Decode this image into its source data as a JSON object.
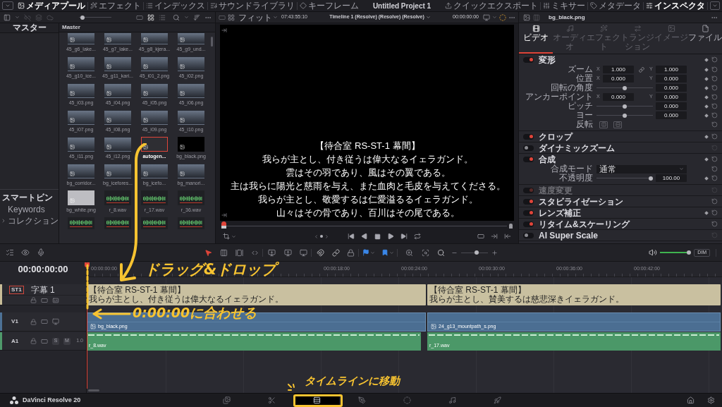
{
  "top_bar": {
    "left_tabs": [
      {
        "label": "メディアプール",
        "kind": "media",
        "selected": true
      },
      {
        "label": "エフェクト",
        "kind": "effects",
        "selected": false
      },
      {
        "label": "インデックス",
        "kind": "index",
        "selected": false
      },
      {
        "label": "サウンドライブラリ",
        "kind": "sound",
        "selected": false
      },
      {
        "label": "キーフレーム",
        "kind": "keyframe",
        "selected": false
      }
    ],
    "title": "Untitled Project 1",
    "right_tabs": [
      {
        "label": "クイックエクスポート",
        "kind": "export",
        "selected": false
      },
      {
        "label": "ミキサー",
        "kind": "mixer",
        "selected": false
      },
      {
        "label": "メタデータ",
        "kind": "metadata",
        "selected": false
      },
      {
        "label": "インスペクタ",
        "kind": "inspector",
        "selected": true
      }
    ]
  },
  "media_pool": {
    "thumbnail_size": {
      "level": 0.05
    },
    "view_modes": [
      {
        "kind": "strip",
        "selected": false
      },
      {
        "kind": "grid",
        "selected": true
      },
      {
        "kind": "list",
        "selected": false
      }
    ],
    "bins_header": "マスター",
    "smart_bins": {
      "title": "スマートビン",
      "items": [
        {
          "label": "Keywords",
          "kind": "item"
        },
        {
          "label": "コレクション",
          "kind": "folder"
        }
      ]
    },
    "header": "Master",
    "clips": [
      {
        "name": "45_g6_lake...",
        "kind": "photo",
        "selected": false
      },
      {
        "name": "45_g7_lake...",
        "kind": "photo",
        "selected": false
      },
      {
        "name": "45_g8_kjera...",
        "kind": "photo",
        "selected": false
      },
      {
        "name": "45_g9_und...",
        "kind": "photo",
        "selected": false
      },
      {
        "name": "45_g10_ice...",
        "kind": "photo",
        "selected": false
      },
      {
        "name": "45_g11_kari...",
        "kind": "photo",
        "selected": false
      },
      {
        "name": "45_i01_2.png",
        "kind": "photo",
        "selected": false
      },
      {
        "name": "45_i02.png",
        "kind": "photo",
        "selected": false
      },
      {
        "name": "45_i03.png",
        "kind": "photo",
        "selected": false
      },
      {
        "name": "45_i04.png",
        "kind": "photo",
        "selected": false
      },
      {
        "name": "45_i05.png",
        "kind": "photo",
        "selected": false
      },
      {
        "name": "45_i06.png",
        "kind": "photo",
        "selected": false
      },
      {
        "name": "45_i07.png",
        "kind": "photo",
        "selected": false
      },
      {
        "name": "45_i08.png",
        "kind": "photo",
        "selected": false
      },
      {
        "name": "45_i09.png",
        "kind": "photo",
        "selected": false
      },
      {
        "name": "45_i10.png",
        "kind": "photo",
        "selected": false
      },
      {
        "name": "45_i11.png",
        "kind": "photo",
        "selected": false
      },
      {
        "name": "45_i12.png",
        "kind": "photo",
        "selected": false
      },
      {
        "name": "autogen...",
        "kind": "empty",
        "selected": true
      },
      {
        "name": "bg_black.png",
        "kind": "black",
        "selected": false
      },
      {
        "name": "bg_corridor...",
        "kind": "photo",
        "selected": false
      },
      {
        "name": "bg_icefores...",
        "kind": "photo",
        "selected": false
      },
      {
        "name": "bg_icefo...",
        "kind": "photo",
        "selected": false
      },
      {
        "name": "bg_manori...",
        "kind": "photo",
        "selected": false
      },
      {
        "name": "bg_white.png",
        "kind": "white",
        "selected": false
      },
      {
        "name": "r_8.wav",
        "kind": "audio",
        "selected": false
      },
      {
        "name": "r_17.wav",
        "kind": "audio",
        "selected": false
      },
      {
        "name": "r_36.wav",
        "kind": "audio",
        "selected": false
      },
      {
        "kind": "audio",
        "selected": false
      },
      {
        "kind": "audio",
        "selected": false
      },
      {
        "kind": "audio",
        "selected": false
      },
      {
        "kind": "audio",
        "selected": false
      }
    ]
  },
  "viewer": {
    "zoom": "フィット",
    "source_timecode": "07:43:55:10",
    "timeline_name": "Timeline 1 (Resolve) (Resolve) (Resolve)",
    "timecode": "00:00:00:00",
    "subtitle": [
      "【待合室 RS-ST-1 幕間】",
      "我らが主とし、付き従うは偉大なるイェラガンド。",
      "雲はその羽であり、風はその翼である。",
      "主は我らに陽光と慈雨を与え、また血肉と毛皮を与えてくださる。",
      "我らが主とし、敬愛するは仁愛溢るるイェラガンド。",
      "山々はその骨であり、百川はその尾である。"
    ],
    "scrubber": {
      "level": 0
    }
  },
  "inspector": {
    "clip_name": "bg_black.png",
    "tabs": [
      {
        "label": "ビデオ",
        "kind": "video",
        "selected": true,
        "disabled": false
      },
      {
        "label": "オーディオ",
        "kind": "audio",
        "selected": false,
        "disabled": true
      },
      {
        "label": "エフェクト",
        "kind": "effects",
        "selected": false,
        "disabled": true
      },
      {
        "label": "トランジション",
        "kind": "transition",
        "selected": false,
        "disabled": true
      },
      {
        "label": "イメージ",
        "kind": "image",
        "selected": false,
        "disabled": true
      },
      {
        "label": "ファイル",
        "kind": "file",
        "selected": false,
        "disabled": false
      }
    ],
    "sections": [
      {
        "title": "変形",
        "on": true,
        "disabled": false,
        "keyframe": true,
        "rows": [
          {
            "kind": "xy",
            "label": "ズーム",
            "linked": true,
            "keyframe": true,
            "fields": [
              {
                "axis": "X",
                "value": "1.000"
              },
              {
                "axis": "Y",
                "value": "1.000"
              }
            ]
          },
          {
            "kind": "xy",
            "label": "位置",
            "linked": false,
            "keyframe": true,
            "fields": [
              {
                "axis": "X",
                "value": "0.000"
              },
              {
                "axis": "Y",
                "value": "0.000"
              }
            ]
          },
          {
            "kind": "slider",
            "label": "回転の角度",
            "level": 0.5,
            "value": "0.000",
            "keyframe": true
          },
          {
            "kind": "xy",
            "label": "アンカーポイント",
            "linked": false,
            "keyframe": true,
            "fields": [
              {
                "axis": "X",
                "value": "0.000"
              },
              {
                "axis": "Y",
                "value": "0.000"
              }
            ]
          },
          {
            "kind": "slider",
            "label": "ピッチ",
            "level": 0.5,
            "value": "0.000",
            "keyframe": true
          },
          {
            "kind": "slider",
            "label": "ヨー",
            "level": 0.5,
            "value": "0.000",
            "keyframe": true
          },
          {
            "kind": "flip",
            "label": "反転",
            "keyframe": false
          }
        ]
      },
      {
        "title": "クロップ",
        "on": true,
        "disabled": false,
        "keyframe": true
      },
      {
        "title": "ダイナミックズーム",
        "on": false,
        "disabled": false,
        "keyframe": false
      },
      {
        "title": "合成",
        "on": true,
        "disabled": false,
        "keyframe": true,
        "rows": [
          {
            "kind": "dropdown",
            "label": "合成モード",
            "value": "通常",
            "keyframe": false
          },
          {
            "kind": "slider",
            "label": "不透明度",
            "level": 1,
            "value": "100.00",
            "keyframe": true
          }
        ]
      },
      {
        "title": "速度変更",
        "on": true,
        "disabled": true,
        "keyframe": false
      },
      {
        "title": "スタビライゼーション",
        "on": true,
        "disabled": false,
        "keyframe": false
      },
      {
        "title": "レンズ補正",
        "on": true,
        "disabled": false,
        "keyframe": true
      },
      {
        "title": "リタイム&スケーリング",
        "on": true,
        "disabled": false,
        "keyframe": false
      },
      {
        "title": "AI Super Scale",
        "on": false,
        "disabled": false,
        "keyframe": false
      }
    ]
  },
  "timeline": {
    "timecode": "00:00:00:00",
    "toolbar": {
      "edit_modes": [
        {
          "kind": "select",
          "selected": true
        },
        {
          "kind": "trim",
          "selected": false
        },
        {
          "kind": "dynamic_trim",
          "selected": false
        },
        {
          "kind": "blade",
          "selected": false
        }
      ],
      "zoom": {
        "level": 0.6
      },
      "volume": {
        "level": 1
      },
      "dim": "DIM"
    },
    "ruler": [
      "00:00:00:00",
      "00:00:18:00",
      "00:00:24:00",
      "00:00:30:00",
      "00:00:36:00",
      "00:00:42:00"
    ],
    "tracks": [
      {
        "kind": "subtitle",
        "id": "ST1",
        "name": "字幕 1",
        "selected": true,
        "clips": [
          {
            "lines": [
              "【待合室 RS-ST-1 幕間】",
              "我らが主とし、付き従うは偉大なるイェラガンド。"
            ]
          },
          {
            "lines": [
              "【待合室 RS-ST-1 幕間】",
              "我らが主とし、賛美するは慈悲深きイェラガンド。"
            ]
          }
        ]
      },
      {
        "kind": "video",
        "id": "V1",
        "selected": false,
        "clips": [
          {
            "name": "bg_black.png"
          },
          {
            "name": "24_g13_mountpath_s.png"
          }
        ]
      },
      {
        "kind": "audio",
        "id": "A1",
        "selected": false,
        "solo": "S",
        "mute": "M",
        "volume": "1.0",
        "clips": [
          {
            "name": "r_8.wav"
          },
          {
            "name": "r_17.wav"
          }
        ]
      }
    ]
  },
  "bottom_bar": {
    "app_name": "DaVinci Resolve 20",
    "pages": [
      {
        "kind": "media",
        "selected": false
      },
      {
        "kind": "cut",
        "selected": false
      },
      {
        "kind": "edit",
        "selected": true
      },
      {
        "kind": "fusion",
        "selected": false
      },
      {
        "kind": "color",
        "selected": false
      },
      {
        "kind": "fairlight",
        "selected": false
      },
      {
        "kind": "deliver",
        "selected": false
      }
    ]
  },
  "annotations": [
    {
      "text": "ドラッグ&ドロップ"
    },
    {
      "text": "0:00:00に合わせる"
    },
    {
      "text": "タイムラインに移動"
    }
  ]
}
